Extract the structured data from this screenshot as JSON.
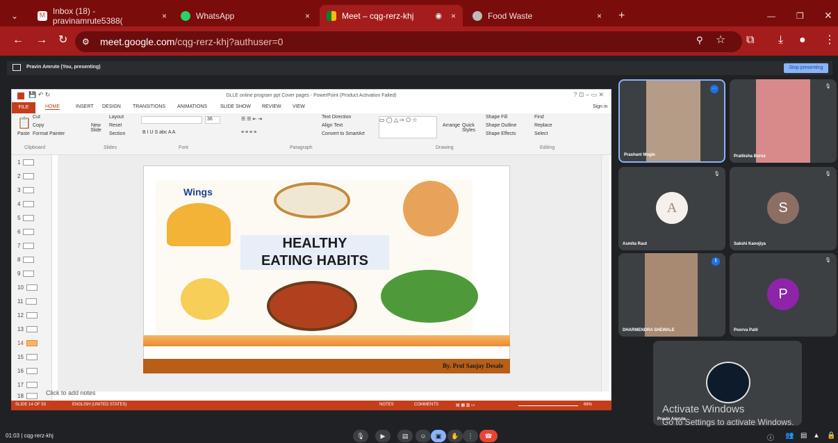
{
  "tabs": [
    {
      "label": "Inbox (18) - pravinamrute5388(",
      "icon": "gmail-icon",
      "close": "×"
    },
    {
      "label": "WhatsApp",
      "icon": "whatsapp-icon",
      "close": "×"
    },
    {
      "label": "Meet – cqg-rerz-khj",
      "icon": "meet-icon",
      "close": "×",
      "active": true
    },
    {
      "label": "Food Waste",
      "icon": "globe-icon",
      "close": "×"
    }
  ],
  "address": {
    "host": "meet.google.com",
    "path": "/cqg-rerz-khj?authuser=0"
  },
  "presenting": {
    "label": "Pravin Amrute (You, presenting)",
    "stop": "Stop presenting"
  },
  "ppt": {
    "window_title": "DLLE online program ppt Cover pages - PowerPoint (Product Activation Failed)",
    "file_tab": "FILE",
    "ribbon_tabs": [
      "HOME",
      "INSERT",
      "DESIGN",
      "TRANSITIONS",
      "ANIMATIONS",
      "SLIDE SHOW",
      "REVIEW",
      "VIEW"
    ],
    "sign_in": "Sign in",
    "ribbon_items": {
      "cut": "Cut",
      "copy": "Copy",
      "paste": "Paste",
      "format_painter": "Format Painter",
      "layout": "Layout",
      "reset": "Reset",
      "new_slide": "New Slide",
      "section": "Section",
      "font_size": "36",
      "text_direction": "Text Direction",
      "align_text": "Align Text",
      "convert": "Convert to SmartArt",
      "arrange": "Arrange",
      "quick_styles": "Quick Styles",
      "shape_fill": "Shape Fill",
      "shape_outline": "Shape Outline",
      "shape_effects": "Shape Effects",
      "find": "Find",
      "replace": "Replace",
      "select": "Select"
    },
    "groups": [
      "Clipboard",
      "Slides",
      "Font",
      "Paragraph",
      "Drawing",
      "Editing"
    ],
    "slide_numbers": [
      "1",
      "2",
      "3",
      "4",
      "5",
      "6",
      "7",
      "8",
      "9",
      "10",
      "11",
      "12",
      "13",
      "14",
      "15",
      "16",
      "17",
      "18"
    ],
    "slide": {
      "logo": "Wings",
      "headline_1": "HEALTHY",
      "headline_2": "EATING HABITS",
      "author": "By. Prof Sanjay Desale"
    },
    "notes_placeholder": "Click to add notes",
    "status": {
      "slide_of": "SLIDE 14 OF 53",
      "language": "ENGLISH (UNITED STATES)",
      "notes": "NOTES",
      "comments": "COMMENTS",
      "zoom": "66%"
    }
  },
  "participants": [
    {
      "name": "Prashant Mogle",
      "type": "video"
    },
    {
      "name": "Pratiksha Borse",
      "type": "video"
    },
    {
      "name": "Asmita Raut",
      "type": "avatar",
      "initial": "A",
      "color": "#f5f0ec"
    },
    {
      "name": "Sakshi Kanojiya",
      "type": "avatar",
      "initial": "S",
      "color": "#8d6e63"
    },
    {
      "name": "DHARMENDRA SHEWALE",
      "type": "video"
    },
    {
      "name": "Poorva Patil",
      "type": "avatar",
      "initial": "P",
      "color": "#8e24aa"
    },
    {
      "name": "Pravin Amrute",
      "type": "logo"
    }
  ],
  "watermark": {
    "line1": "Activate Windows",
    "line2": "Go to Settings to activate Windows."
  },
  "meeting": {
    "time_code": "01:03  |  cqg-rerz-khj"
  }
}
